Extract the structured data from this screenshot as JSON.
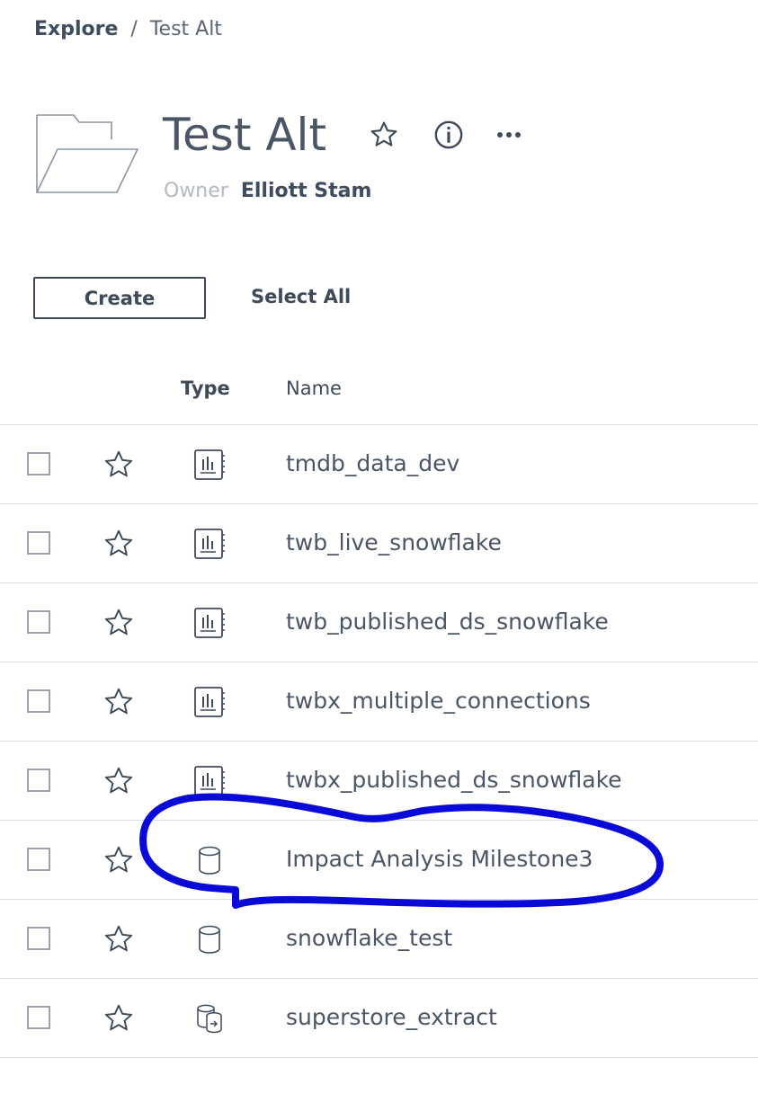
{
  "breadcrumb": {
    "parent": "Explore",
    "separator": "/",
    "current": "Test Alt"
  },
  "header": {
    "title": "Test Alt",
    "owner_label": "Owner",
    "owner_name": "Elliott Stam",
    "icons": [
      "folder-icon",
      "star-icon",
      "info-icon",
      "more-icon"
    ]
  },
  "actions": {
    "create_label": "Create",
    "select_all_label": "Select All"
  },
  "table": {
    "columns": [
      "Type",
      "Name"
    ],
    "rows": [
      {
        "name": "tmdb_data_dev",
        "type": "workbook"
      },
      {
        "name": "twb_live_snowflake",
        "type": "workbook"
      },
      {
        "name": "twb_published_ds_snowflake",
        "type": "workbook"
      },
      {
        "name": "twbx_multiple_connections",
        "type": "workbook"
      },
      {
        "name": "twbx_published_ds_snowflake",
        "type": "workbook"
      },
      {
        "name": "Impact Analysis Milestone3",
        "type": "datasource"
      },
      {
        "name": "snowflake_test",
        "type": "datasource"
      },
      {
        "name": "superstore_extract",
        "type": "extract-datasource"
      }
    ]
  },
  "colors": {
    "text": "#3e4a5a",
    "muted": "#b3b9c2",
    "divider": "#d9dde2",
    "annotation": "#0a0ad8"
  }
}
